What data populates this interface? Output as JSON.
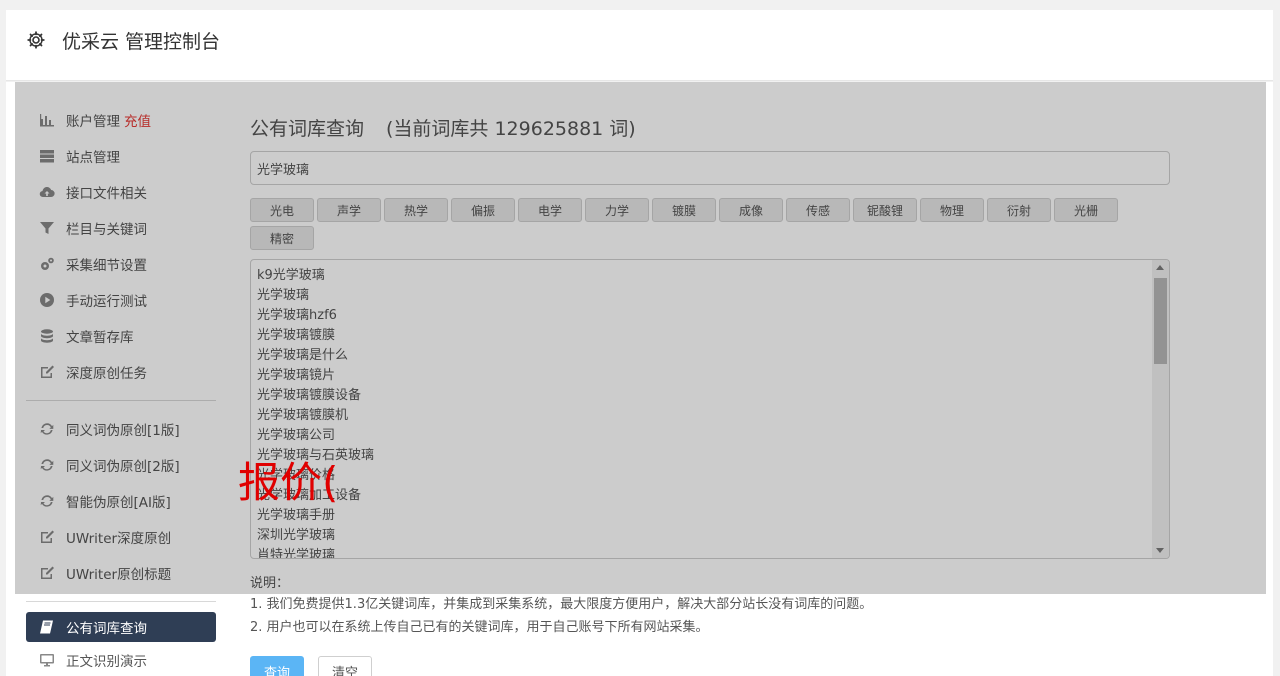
{
  "header": {
    "title": "优采云 管理控制台",
    "icon": "gear-icon"
  },
  "sidebar": {
    "items": [
      {
        "label": "账户管理",
        "extra": "充值",
        "icon": "bar-chart-icon"
      },
      {
        "label": "站点管理",
        "icon": "server-icon"
      },
      {
        "label": "接口文件相关",
        "icon": "cloud-upload-icon"
      },
      {
        "label": "栏目与关键词",
        "icon": "filter-icon"
      },
      {
        "label": "采集细节设置",
        "icon": "gears-icon"
      },
      {
        "label": "手动运行测试",
        "icon": "play-circle-icon"
      },
      {
        "label": "文章暂存库",
        "icon": "database-icon"
      },
      {
        "label": "深度原创任务",
        "icon": "edit-icon"
      }
    ],
    "items2": [
      {
        "label": "同义词伪原创[1版]",
        "icon": "refresh-icon"
      },
      {
        "label": "同义词伪原创[2版]",
        "icon": "refresh-icon"
      },
      {
        "label": "智能伪原创[AI版]",
        "icon": "refresh-icon"
      },
      {
        "label": "UWriter深度原创",
        "icon": "edit-icon"
      },
      {
        "label": "UWriter原创标题",
        "icon": "edit-icon"
      }
    ],
    "items3": [
      {
        "label": "公有词库查询",
        "icon": "book-icon",
        "active": true
      },
      {
        "label": "正文识别演示",
        "icon": "monitor-icon"
      }
    ]
  },
  "content": {
    "heading": "公有词库查询",
    "count": "(当前词库共 129625881 词)",
    "search_value": "光学玻璃",
    "tags": [
      "光电",
      "声学",
      "热学",
      "偏振",
      "电学",
      "力学",
      "镀膜",
      "成像",
      "传感",
      "铌酸锂",
      "物理",
      "衍射",
      "光栅",
      "精密"
    ],
    "results": [
      "k9光学玻璃",
      "光学玻璃",
      "光学玻璃hzf6",
      "光学玻璃镀膜",
      "光学玻璃是什么",
      "光学玻璃镜片",
      "光学玻璃镀膜设备",
      "光学玻璃镀膜机",
      "光学玻璃公司",
      "光学玻璃与石英玻璃",
      "光学玻璃价格",
      "光学玻璃加工设备",
      "光学玻璃手册",
      "深圳光学玻璃",
      "肖特光学玻璃"
    ],
    "note_label": "说明：",
    "notes": [
      "1. 我们免费提供1.3亿关键词库，并集成到采集系统，最大限度方便用户，解决大部分站长没有词库的问题。",
      "2. 用户也可以在系统上传自己已有的关键词库，用于自己账号下所有网站采集。"
    ],
    "query_button": "查询",
    "clear_button": "清空"
  },
  "watermark": "报价(",
  "colors": {
    "accent": "#2f3e55",
    "query": "#5bb5f5",
    "recharge": "#e53935",
    "watermark": "#e00000"
  }
}
